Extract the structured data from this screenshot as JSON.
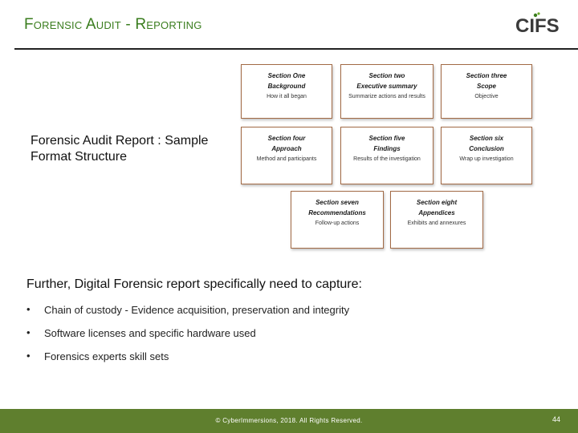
{
  "slide": {
    "title": "Forensic Audit - Reporting",
    "subtitle": "Forensic Audit Report : Sample Format Structure",
    "logo_text": "CIFS",
    "colors": {
      "title": "#3a7d1e",
      "footer": "#5f7f2e",
      "card_border": "#a26a45"
    }
  },
  "cards": [
    {
      "section": "Section One",
      "name": "Background",
      "desc": "How it all began"
    },
    {
      "section": "Section two",
      "name": "Executive summary",
      "desc": "Summarize actions and results"
    },
    {
      "section": "Section three",
      "name": "Scope",
      "desc": "Objective"
    },
    {
      "section": "Section four",
      "name": "Approach",
      "desc": "Method and participants"
    },
    {
      "section": "Section five",
      "name": "Findings",
      "desc": "Results of the investigation"
    },
    {
      "section": "Section six",
      "name": "Conclusion",
      "desc": "Wrap up investigation"
    },
    {
      "section": "Section seven",
      "name": "Recommendations",
      "desc": "Follow-up actions"
    },
    {
      "section": "Section eight",
      "name": "Appendices",
      "desc": "Exhibits and annexures"
    }
  ],
  "further": {
    "heading": "Further, Digital Forensic report specifically need to capture:",
    "bullet_symbol": "•",
    "items": [
      "Chain of custody - Evidence acquisition, preservation and integrity",
      "Software licenses and specific hardware used",
      "Forensics experts skill sets"
    ]
  },
  "footer": {
    "copyright": "© CyberImmersions, 2018. All Rights Reserved.",
    "page_number": "44"
  }
}
